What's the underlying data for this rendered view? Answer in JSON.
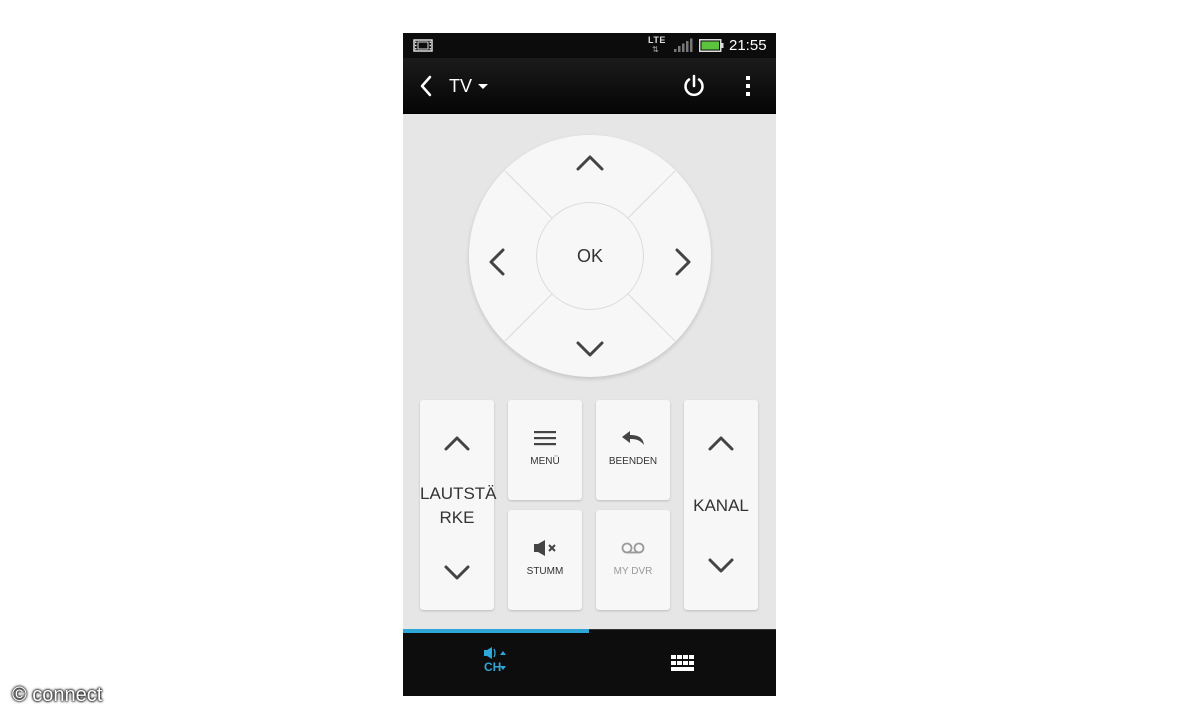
{
  "status_bar": {
    "network": "LTE",
    "time": "21:55",
    "icons": [
      "film-icon",
      "data-arrows-icon",
      "signal-icon",
      "battery-icon"
    ]
  },
  "app_bar": {
    "device": "TV",
    "icons": [
      "back-arrow-icon",
      "dropdown-caret-icon",
      "power-icon",
      "overflow-menu-icon"
    ]
  },
  "dpad": {
    "ok_label": "OK",
    "icons": [
      "chevron-up-icon",
      "chevron-down-icon",
      "chevron-left-icon",
      "chevron-right-icon"
    ]
  },
  "keys": {
    "volume_label_1": "LAUTSTÄ",
    "volume_label_2": "RKE",
    "menu_label": "MENÜ",
    "exit_label": "BEENDEN",
    "mute_label": "STUMM",
    "dvr_label": "MY DVR",
    "channel_label": "KANAL"
  },
  "bottom_tabs": {
    "remote_tab_text": "CH",
    "icons": [
      "volume-channel-icon",
      "keypad-icon"
    ]
  },
  "watermark": "© connect",
  "colors": {
    "accent": "#2fa6d8",
    "background": "#e6e6e6",
    "key_face": "#f7f7f7",
    "bar_dark": "#0c0c0c"
  }
}
